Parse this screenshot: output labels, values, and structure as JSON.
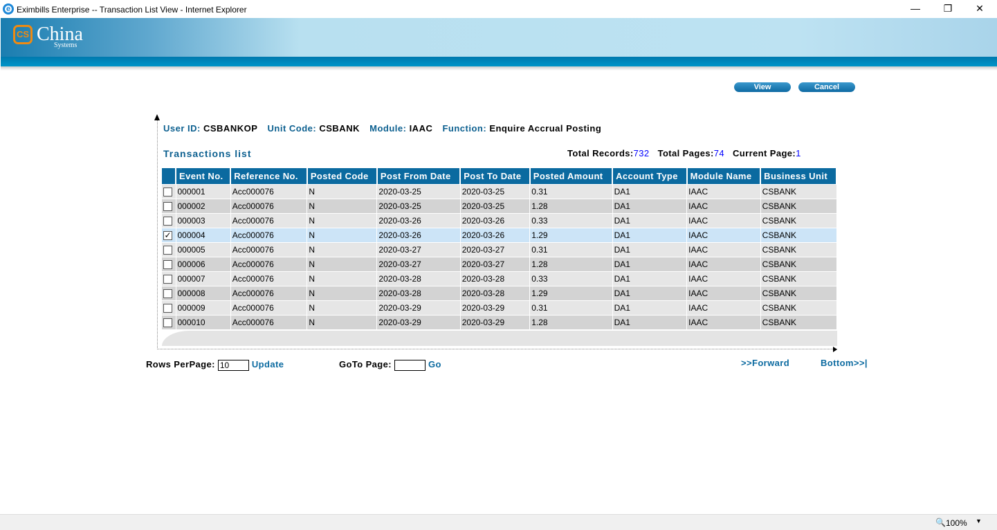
{
  "window": {
    "title": "Eximbills Enterprise -- Transaction List View - Internet Explorer"
  },
  "banner": {
    "logo_mark": "CS",
    "logo_text": "China",
    "logo_sub": "Systems"
  },
  "toolbar": {
    "view": "View",
    "cancel": "Cancel"
  },
  "info": {
    "user_id_label": "User ID:",
    "user_id": "CSBANKOP",
    "unit_code_label": "Unit Code:",
    "unit_code": "CSBANK",
    "module_label": "Module:",
    "module": "IAAC",
    "function_label": "Function:",
    "function": "Enquire Accrual Posting"
  },
  "list": {
    "title": "Transactions list",
    "total_records_label": "Total Records:",
    "total_records": "732",
    "total_pages_label": "Total Pages:",
    "total_pages": "74",
    "current_page_label": "Current Page:",
    "current_page": "1"
  },
  "columns": [
    "Event No.",
    "Reference No.",
    "Posted Code",
    "Post From Date",
    "Post To Date",
    "Posted Amount",
    "Account Type",
    "Module Name",
    "Business Unit"
  ],
  "rows": [
    {
      "checked": false,
      "cells": [
        "000001",
        "Acc000076",
        "N",
        "2020-03-25",
        "2020-03-25",
        "0.31",
        "DA1",
        "IAAC",
        "CSBANK"
      ]
    },
    {
      "checked": false,
      "cells": [
        "000002",
        "Acc000076",
        "N",
        "2020-03-25",
        "2020-03-25",
        "1.28",
        "DA1",
        "IAAC",
        "CSBANK"
      ]
    },
    {
      "checked": false,
      "cells": [
        "000003",
        "Acc000076",
        "N",
        "2020-03-26",
        "2020-03-26",
        "0.33",
        "DA1",
        "IAAC",
        "CSBANK"
      ]
    },
    {
      "checked": true,
      "cells": [
        "000004",
        "Acc000076",
        "N",
        "2020-03-26",
        "2020-03-26",
        "1.29",
        "DA1",
        "IAAC",
        "CSBANK"
      ]
    },
    {
      "checked": false,
      "cells": [
        "000005",
        "Acc000076",
        "N",
        "2020-03-27",
        "2020-03-27",
        "0.31",
        "DA1",
        "IAAC",
        "CSBANK"
      ]
    },
    {
      "checked": false,
      "cells": [
        "000006",
        "Acc000076",
        "N",
        "2020-03-27",
        "2020-03-27",
        "1.28",
        "DA1",
        "IAAC",
        "CSBANK"
      ]
    },
    {
      "checked": false,
      "cells": [
        "000007",
        "Acc000076",
        "N",
        "2020-03-28",
        "2020-03-28",
        "0.33",
        "DA1",
        "IAAC",
        "CSBANK"
      ]
    },
    {
      "checked": false,
      "cells": [
        "000008",
        "Acc000076",
        "N",
        "2020-03-28",
        "2020-03-28",
        "1.29",
        "DA1",
        "IAAC",
        "CSBANK"
      ]
    },
    {
      "checked": false,
      "cells": [
        "000009",
        "Acc000076",
        "N",
        "2020-03-29",
        "2020-03-29",
        "0.31",
        "DA1",
        "IAAC",
        "CSBANK"
      ]
    },
    {
      "checked": false,
      "cells": [
        "000010",
        "Acc000076",
        "N",
        "2020-03-29",
        "2020-03-29",
        "1.28",
        "DA1",
        "IAAC",
        "CSBANK"
      ]
    }
  ],
  "footer": {
    "rows_per_page_label": "Rows PerPage:",
    "rows_per_page": "10",
    "update": "Update",
    "goto_label": "GoTo Page:",
    "goto_value": "",
    "go": "Go",
    "forward": ">>Forward",
    "bottom": "Bottom>>|"
  },
  "statusbar": {
    "zoom": "100%"
  }
}
